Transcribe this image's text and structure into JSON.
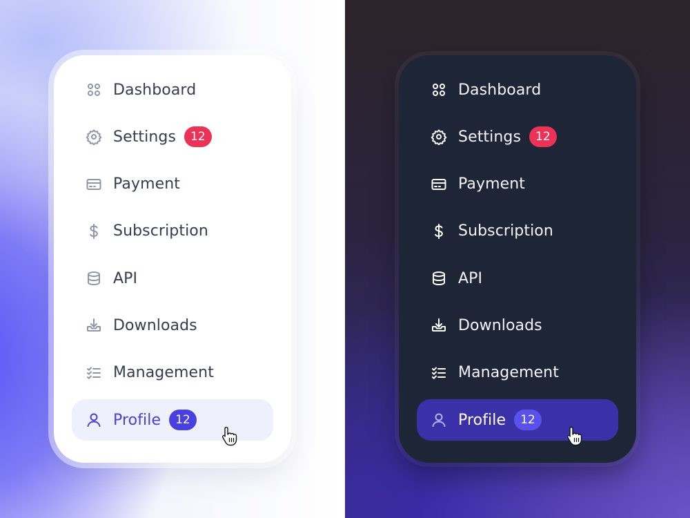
{
  "menu_items": [
    {
      "label": "Dashboard",
      "icon": "grid-icon"
    },
    {
      "label": "Settings",
      "icon": "gear-icon",
      "badge": "12"
    },
    {
      "label": "Payment",
      "icon": "credit-card-icon"
    },
    {
      "label": "Subscription",
      "icon": "dollar-icon"
    },
    {
      "label": "API",
      "icon": "database-icon"
    },
    {
      "label": "Downloads",
      "icon": "download-icon"
    },
    {
      "label": "Management",
      "icon": "checklist-icon"
    },
    {
      "label": "Profile",
      "icon": "user-icon",
      "badge": "12",
      "active": true
    }
  ],
  "colors": {
    "badge_alert": "#ec3357",
    "badge_active": "#4a3fe0",
    "active_text_light": "#4b3fd6",
    "card_dark": "#1e2537",
    "card_light": "#ffffff"
  },
  "themes": [
    "light",
    "dark"
  ]
}
